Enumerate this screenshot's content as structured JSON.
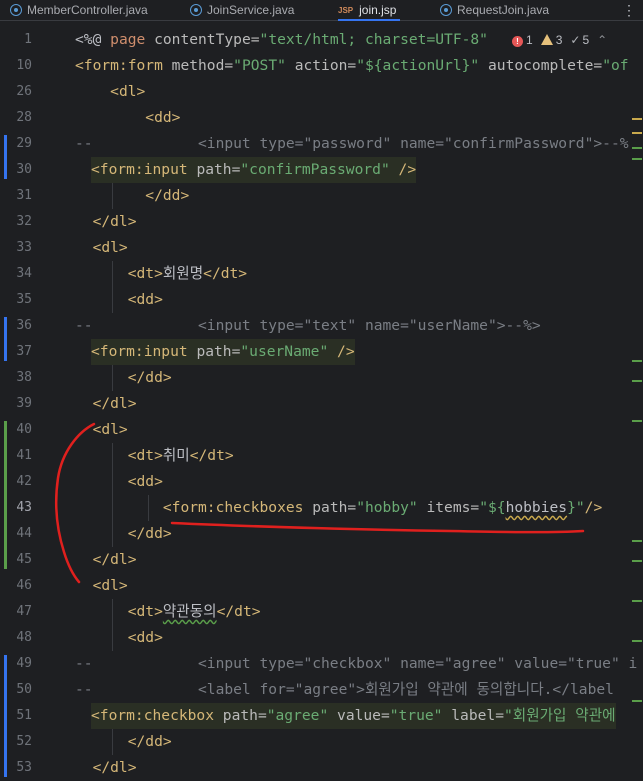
{
  "tabs": [
    {
      "label": "MemberController.java",
      "kind": "java"
    },
    {
      "label": "JoinService.java",
      "kind": "java"
    },
    {
      "label": "join.jsp",
      "kind": "jsp",
      "badge": "JSP",
      "active": true
    },
    {
      "label": "RequestJoin.java",
      "kind": "java"
    }
  ],
  "tab_more": "⋮",
  "inspections": {
    "errors": "1",
    "warnings": "3",
    "ok": "5",
    "up": "⌃"
  },
  "lines": [
    {
      "n": "1",
      "segs": [
        [
          "em",
          "<%@ "
        ],
        [
          "kw",
          "page "
        ],
        [
          "at",
          "contentType="
        ],
        [
          "sv",
          "\"text/html; charset=UTF-8\""
        ]
      ]
    },
    {
      "n": "10",
      "segs": [
        [
          "tg",
          "<form:form "
        ],
        [
          "at",
          "method="
        ],
        [
          "sv",
          "\"POST\" "
        ],
        [
          "at",
          "action="
        ],
        [
          "sv",
          "\"${actionUrl}\" "
        ],
        [
          "at",
          "autocomplete="
        ],
        [
          "sv",
          "\"of"
        ]
      ]
    },
    {
      "n": "26",
      "indent": "    ",
      "segs": [
        [
          "tg",
          "<dl>"
        ]
      ]
    },
    {
      "n": "28",
      "indent": "        ",
      "segs": [
        [
          "tg",
          "<dd>"
        ]
      ]
    },
    {
      "n": "29",
      "segs": [
        [
          "cm",
          "--            <input type=\"password\" name=\"confirmPassword\">--%"
        ]
      ]
    },
    {
      "n": "30",
      "hl": true,
      "segs": [
        [
          "tg",
          "<form:input "
        ],
        [
          "at",
          "path="
        ],
        [
          "sv",
          "\"confirmPassword\" "
        ],
        [
          "tg",
          "/>"
        ]
      ]
    },
    {
      "n": "31",
      "indent": "        ",
      "segs": [
        [
          "tg",
          "</dd>"
        ]
      ]
    },
    {
      "n": "32",
      "indent": "  ",
      "segs": [
        [
          "tg",
          "</dl>"
        ]
      ]
    },
    {
      "n": "33",
      "indent": "  ",
      "segs": [
        [
          "tg",
          "<dl>"
        ]
      ]
    },
    {
      "n": "34",
      "indent": "      ",
      "segs": [
        [
          "tg",
          "<dt>"
        ],
        [
          "em",
          "회원명"
        ],
        [
          "tg",
          "</dt>"
        ]
      ]
    },
    {
      "n": "35",
      "indent": "      ",
      "segs": [
        [
          "tg",
          "<dd>"
        ]
      ]
    },
    {
      "n": "36",
      "segs": [
        [
          "cm",
          "--            <input type=\"text\" name=\"userName\">--%>"
        ]
      ]
    },
    {
      "n": "37",
      "hl": true,
      "segs": [
        [
          "tg",
          "<form:input "
        ],
        [
          "at",
          "path="
        ],
        [
          "sv",
          "\"userName\" "
        ],
        [
          "tg",
          "/>"
        ]
      ]
    },
    {
      "n": "38",
      "indent": "      ",
      "segs": [
        [
          "tg",
          "</dd>"
        ]
      ]
    },
    {
      "n": "39",
      "indent": "  ",
      "segs": [
        [
          "tg",
          "</dl>"
        ]
      ]
    },
    {
      "n": "40",
      "indent": "  ",
      "segs": [
        [
          "tg",
          "<dl>"
        ]
      ]
    },
    {
      "n": "41",
      "indent": "      ",
      "segs": [
        [
          "tg",
          "<dt>"
        ],
        [
          "em",
          "취미"
        ],
        [
          "tg",
          "</dt>"
        ]
      ]
    },
    {
      "n": "42",
      "indent": "      ",
      "segs": [
        [
          "tg",
          "<dd>"
        ]
      ]
    },
    {
      "n": "43",
      "indent": "          ",
      "cur": true,
      "segs": [
        [
          "tg",
          "<form:checkboxes "
        ],
        [
          "at",
          "path="
        ],
        [
          "sv",
          "\"hobby\" "
        ],
        [
          "at",
          "items="
        ],
        [
          "sv",
          "\"${"
        ],
        [
          "em",
          "hobbies"
        ],
        [
          "sv",
          "}\""
        ],
        [
          "tg",
          "/>"
        ]
      ]
    },
    {
      "n": "44",
      "indent": "      ",
      "segs": [
        [
          "tg",
          "</dd>"
        ]
      ]
    },
    {
      "n": "45",
      "indent": "  ",
      "segs": [
        [
          "tg",
          "</dl>"
        ]
      ]
    },
    {
      "n": "46",
      "indent": "  ",
      "segs": [
        [
          "tg",
          "<dl>"
        ]
      ]
    },
    {
      "n": "47",
      "indent": "      ",
      "segs": [
        [
          "tg",
          "<dt>"
        ],
        [
          "em",
          "약관동의"
        ],
        [
          "tg",
          "</dt>"
        ]
      ]
    },
    {
      "n": "48",
      "indent": "      ",
      "segs": [
        [
          "tg",
          "<dd>"
        ]
      ]
    },
    {
      "n": "49",
      "segs": [
        [
          "cm",
          "--            <input type=\"checkbox\" name=\"agree\" value=\"true\" i"
        ]
      ]
    },
    {
      "n": "50",
      "segs": [
        [
          "cm",
          "--            <label for=\"agree\">회원가입 약관에 동의합니다.</label"
        ]
      ]
    },
    {
      "n": "51",
      "hl": true,
      "segs": [
        [
          "tg",
          "<form:checkbox "
        ],
        [
          "at",
          "path="
        ],
        [
          "sv",
          "\"agree\" "
        ],
        [
          "at",
          "value="
        ],
        [
          "sv",
          "\"true\" "
        ],
        [
          "at",
          "label="
        ],
        [
          "sv",
          "\"회원가입 약관에"
        ]
      ]
    },
    {
      "n": "52",
      "indent": "      ",
      "segs": [
        [
          "tg",
          "</dd>"
        ]
      ]
    },
    {
      "n": "53",
      "indent": "  ",
      "segs": [
        [
          "tg",
          "</dl>"
        ]
      ]
    }
  ],
  "colors": {
    "tag": "#d5b778",
    "attr": "#bababa",
    "string": "#6aab73",
    "comment": "#7a7e85",
    "annotation": "#e0201e",
    "modified": "#3574f0",
    "added": "#5a9e4a"
  }
}
